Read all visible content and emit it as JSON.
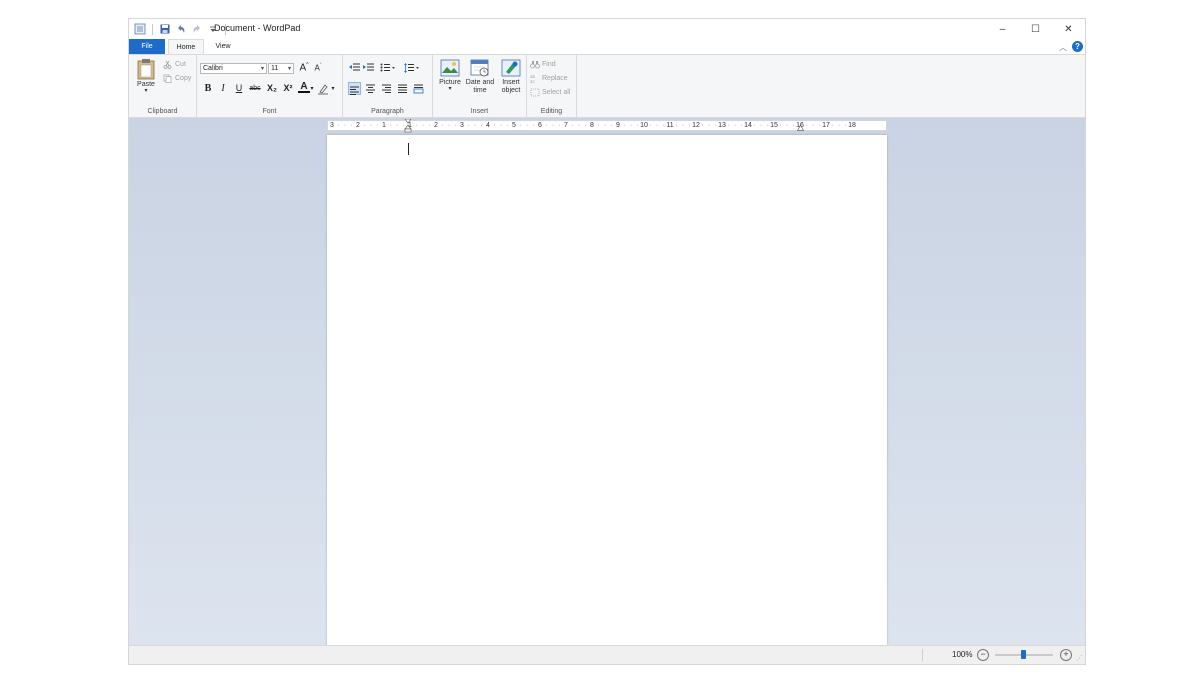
{
  "window": {
    "title": "Document - WordPad"
  },
  "window_controls": {
    "minimize": "–",
    "maximize": "☐",
    "close": "✕"
  },
  "tabs": {
    "file": "File",
    "home": "Home",
    "view": "View"
  },
  "help": "?",
  "ribbon": {
    "clipboard": {
      "label": "Clipboard",
      "paste": "Paste",
      "cut": "Cut",
      "copy": "Copy"
    },
    "font": {
      "label": "Font",
      "family": "Calibri",
      "size": "11",
      "bold": "B",
      "italic": "I",
      "underline": "U",
      "strike": "abc",
      "subscript": "X₂",
      "superscript": "X²",
      "text_color": "A"
    },
    "paragraph": {
      "label": "Paragraph"
    },
    "insert": {
      "label": "Insert",
      "picture": "Picture",
      "date_and_time_1": "Date and",
      "date_and_time_2": "time",
      "insert_object_1": "Insert",
      "insert_object_2": "object"
    },
    "editing": {
      "label": "Editing",
      "find": "Find",
      "replace": "Replace",
      "select_all": "Select all"
    }
  },
  "ruler": {
    "labels": [
      "3",
      "2",
      "1",
      "1",
      "2",
      "3",
      "4",
      "5",
      "6",
      "7",
      "8",
      "9",
      "10",
      "11",
      "12",
      "13",
      "14",
      "15",
      "16",
      "17",
      "18"
    ]
  },
  "status": {
    "zoom": "100%",
    "zoom_level_percent": 100
  },
  "colors": {
    "accent": "#1e6cc7",
    "workspace": "#c9d3e3"
  }
}
